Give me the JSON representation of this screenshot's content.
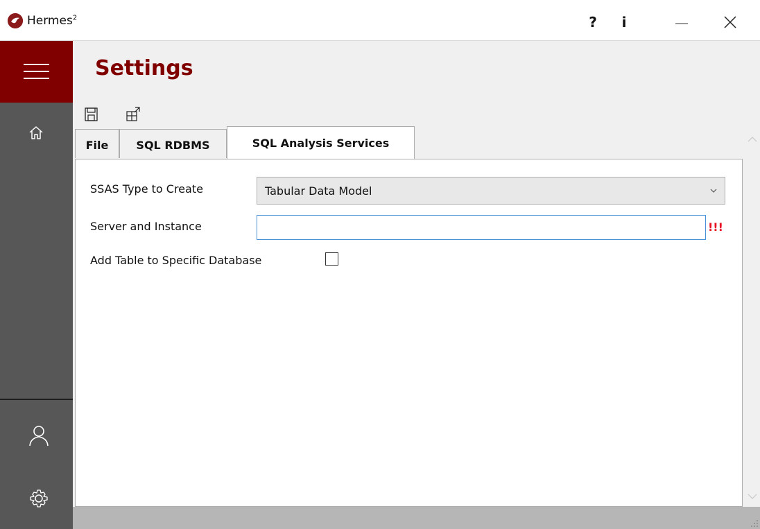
{
  "window": {
    "title": "Hermes",
    "title_superscript": "2",
    "help_label": "?",
    "info_label": "i"
  },
  "sidebar": {
    "items": [
      {
        "name": "menu",
        "icon": "hamburger-menu-icon"
      },
      {
        "name": "home",
        "icon": "home-icon"
      },
      {
        "name": "user",
        "icon": "user-icon"
      },
      {
        "name": "settings",
        "icon": "gear-icon"
      }
    ]
  },
  "page": {
    "title": "Settings"
  },
  "toolbar": {
    "icons": [
      "save-icon",
      "export-settings-icon"
    ]
  },
  "tabs": [
    {
      "label": "File",
      "active": false
    },
    {
      "label": "SQL RDBMS",
      "active": false
    },
    {
      "label": "SQL Analysis Services",
      "active": true
    }
  ],
  "form": {
    "ssas_type": {
      "label": "SSAS Type to Create",
      "value": "Tabular Data Model"
    },
    "server_instance": {
      "label": "Server and Instance",
      "value": "",
      "required_mark": "!!!"
    },
    "add_table_db": {
      "label": "Add Table to Specific Database",
      "checked": false
    }
  },
  "colors": {
    "accent": "#800000",
    "sidebar": "#575757",
    "error": "#e81123"
  }
}
